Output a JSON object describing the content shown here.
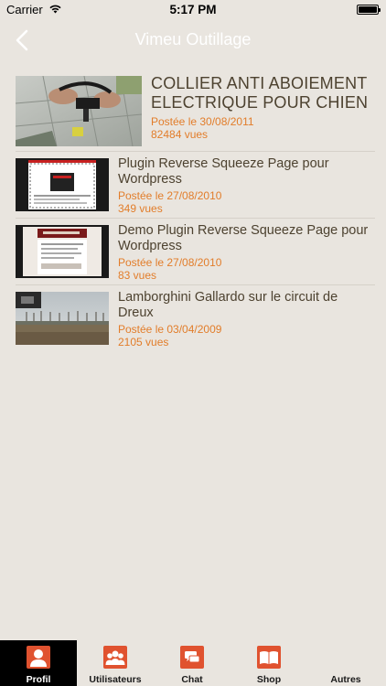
{
  "status_bar": {
    "carrier": "Carrier",
    "time": "5:17 PM"
  },
  "nav": {
    "title": "Vimeu Outillage",
    "back_icon": "chevron-left-icon"
  },
  "colors": {
    "background": "#e9e5df",
    "accent_orange": "#e27d2a",
    "tab_icon_red": "#e0522f",
    "title_brown": "#4d4230"
  },
  "videos": [
    {
      "title": "COLLIER ANTI ABOIEMENT ELECTRIQUE POUR CHIEN",
      "date": "Postée le 30/08/2011",
      "views": "82484 vues"
    },
    {
      "title": "Plugin Reverse Squeeze Page pour Wordpress",
      "date": "Postée le 27/08/2010",
      "views": "349 vues"
    },
    {
      "title": "Demo Plugin Reverse Squeeze Page pour Wordpress",
      "date": "Postée le 27/08/2010",
      "views": "83 vues"
    },
    {
      "title": "Lamborghini Gallardo sur le circuit de Dreux",
      "date": "Postée le 03/04/2009",
      "views": "2105 vues"
    }
  ],
  "tabs": [
    {
      "label": "Profil",
      "icon": "profile-icon",
      "active": true
    },
    {
      "label": "Utilisateurs",
      "icon": "users-icon",
      "active": false
    },
    {
      "label": "Chat",
      "icon": "chat-icon",
      "active": false
    },
    {
      "label": "Shop",
      "icon": "book-icon",
      "active": false
    },
    {
      "label": "Autres",
      "icon": "more-icon",
      "active": false
    }
  ]
}
